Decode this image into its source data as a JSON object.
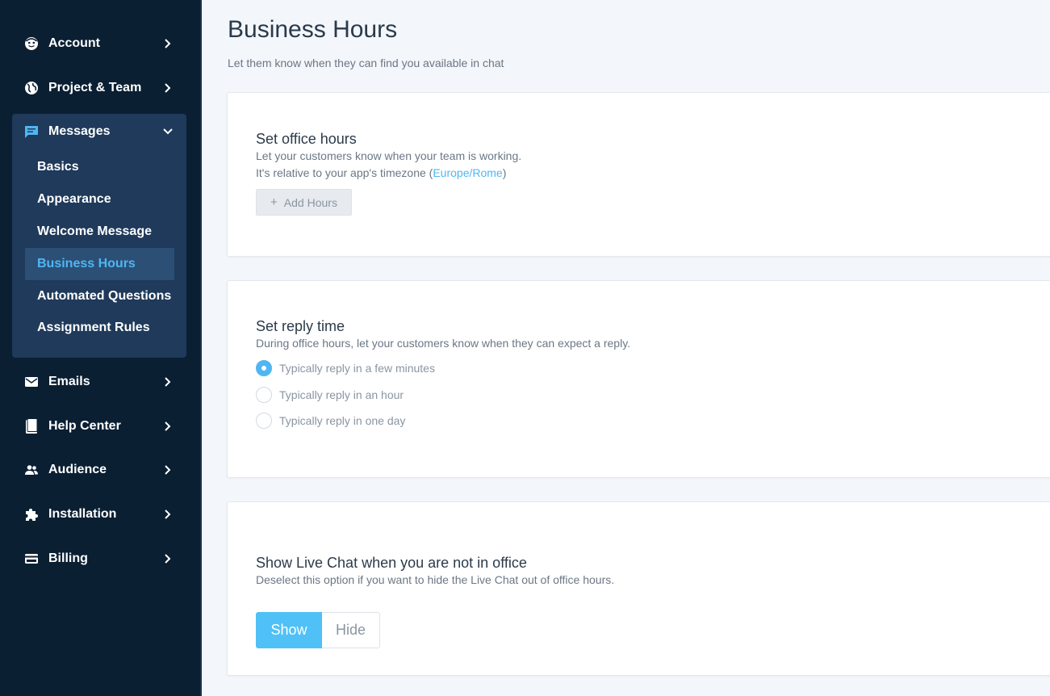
{
  "sidebar": {
    "account": "Account",
    "project_team": "Project & Team",
    "messages": "Messages",
    "messages_sub": {
      "basics": "Basics",
      "appearance": "Appearance",
      "welcome_message": "Welcome Message",
      "business_hours": "Business Hours",
      "automated_questions": "Automated Questions",
      "assignment_rules": "Assignment Rules"
    },
    "emails": "Emails",
    "help_center": "Help Center",
    "audience": "Audience",
    "installation": "Installation",
    "billing": "Billing"
  },
  "page": {
    "title": "Business Hours",
    "subtitle": "Let them know when they can find you available in chat"
  },
  "office_hours": {
    "title": "Set office hours",
    "line1": "Let your customers know when your team is working.",
    "line2_prefix": "It's relative to your app's timezone (",
    "timezone": "Europe/Rome",
    "line2_suffix": ")",
    "add_button": "Add Hours"
  },
  "reply_time": {
    "title": "Set reply time",
    "description": "During office hours, let your customers know when they can expect a reply.",
    "options": [
      {
        "label": "Typically reply in a few minutes",
        "selected": true
      },
      {
        "label": "Typically reply in an hour",
        "selected": false
      },
      {
        "label": "Typically reply in one day",
        "selected": false
      }
    ]
  },
  "live_chat": {
    "title": "Show Live Chat when you are not in office",
    "description": "Deselect this option if you want to hide the Live Chat out of office hours.",
    "show_label": "Show",
    "hide_label": "Hide",
    "selected": "Show"
  },
  "colors": {
    "sidebar_bg": "#0b1f33",
    "group_bg": "#1f3a5a",
    "accent": "#4fb6f2"
  },
  "icons": {
    "account": "account-circle-icon",
    "project_team": "globe-icon",
    "messages": "chat-icon",
    "emails": "envelope-icon",
    "help_center": "book-icon",
    "audience": "people-icon",
    "installation": "puzzle-icon",
    "billing": "credit-card-icon"
  }
}
